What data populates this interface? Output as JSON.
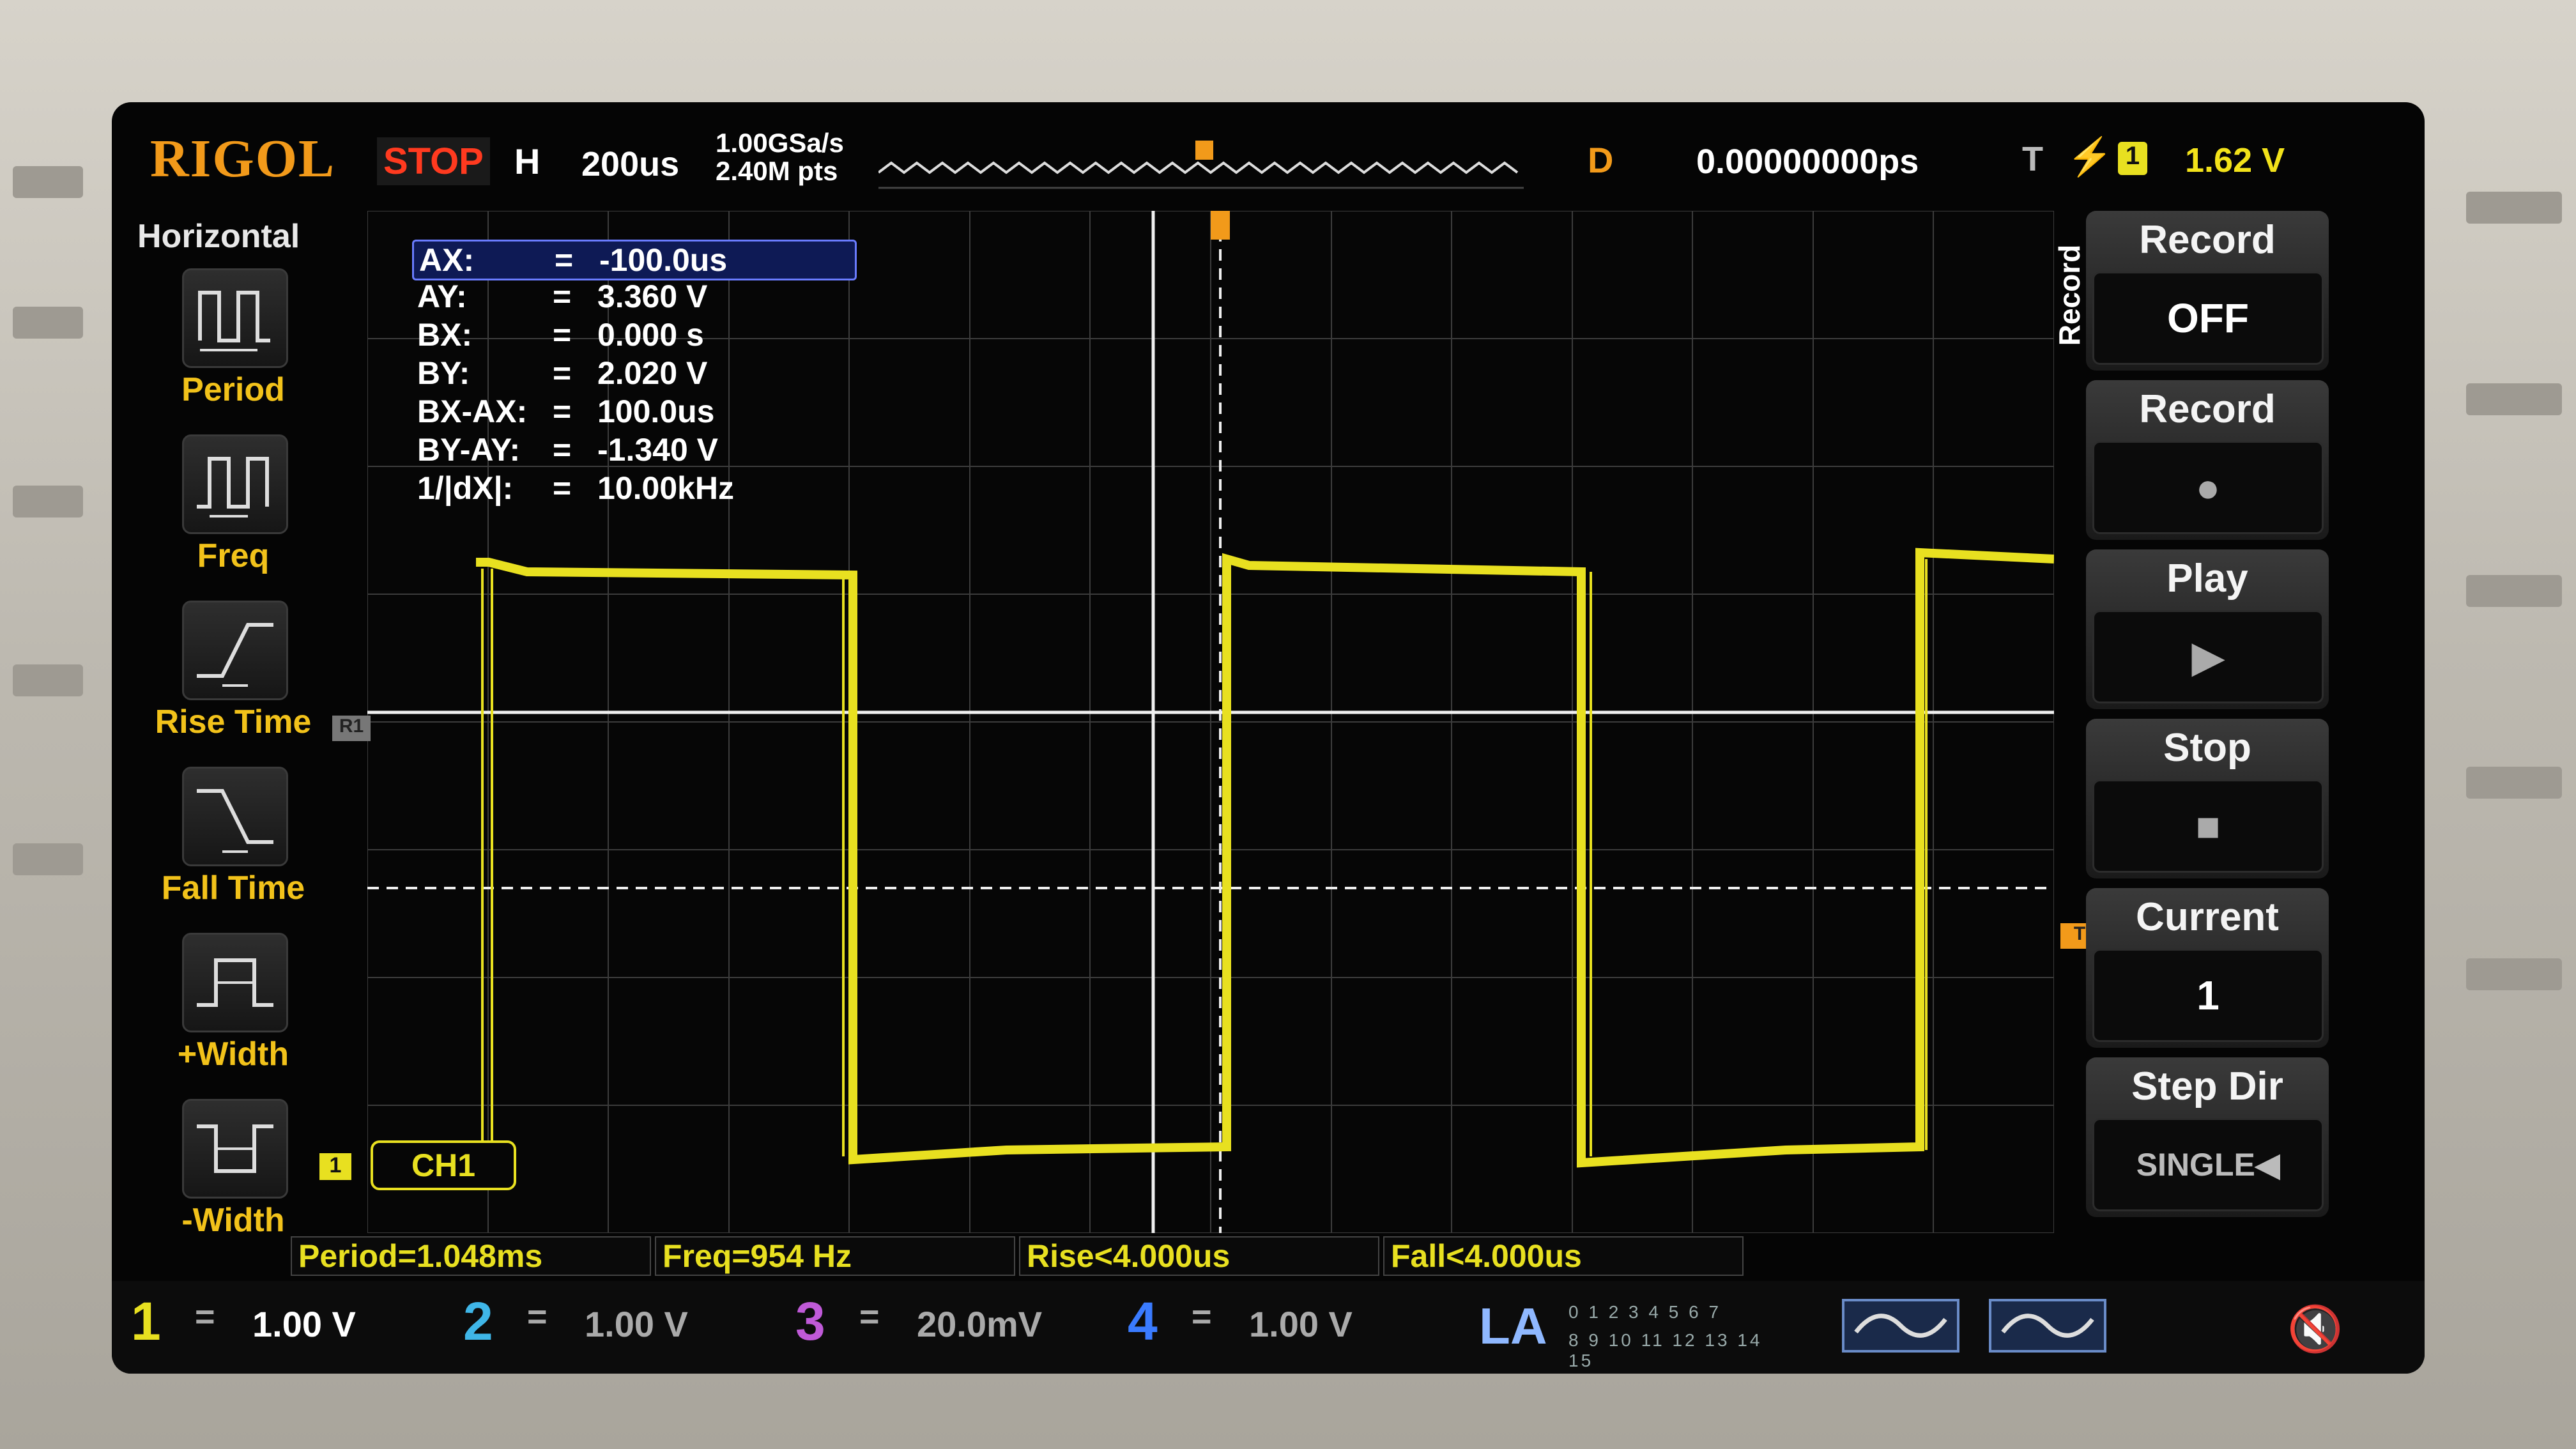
{
  "topbar": {
    "brand": "RIGOL",
    "run_status": "STOP",
    "horizontal_mode": "H",
    "timebase": "200us",
    "sample_rate": "1.00GSa/s",
    "memory_depth": "2.40M pts",
    "delay_mode": "D",
    "delay": "0.00000000ps",
    "trigger_type": "T",
    "trigger_edge_icon": "rising-edge-icon",
    "trigger_source": "1",
    "trigger_level": "1.62 V"
  },
  "left_menu": {
    "title": "Horizontal",
    "items": [
      {
        "label": "Period",
        "icon": "period-icon"
      },
      {
        "label": "Freq",
        "icon": "freq-icon"
      },
      {
        "label": "Rise Time",
        "icon": "rise-time-icon"
      },
      {
        "label": "Fall Time",
        "icon": "fall-time-icon"
      },
      {
        "label": "+Width",
        "icon": "positive-width-icon"
      },
      {
        "label": "-Width",
        "icon": "negative-width-icon"
      }
    ]
  },
  "cursor_readout": [
    {
      "key": "AX:",
      "eq": "=",
      "value": "-100.0us"
    },
    {
      "key": "AY:",
      "eq": "=",
      "value": "3.360 V"
    },
    {
      "key": "BX:",
      "eq": "=",
      "value": "0.000 s"
    },
    {
      "key": "BY:",
      "eq": "=",
      "value": "2.020 V"
    },
    {
      "key": "BX-AX:",
      "eq": "=",
      "value": "100.0us"
    },
    {
      "key": "BY-AY:",
      "eq": "=",
      "value": "-1.340 V"
    },
    {
      "key": "1/|dX|:",
      "eq": "=",
      "value": "10.00kHz"
    }
  ],
  "markers": {
    "ch1_marker": "1",
    "ch1_tag": "CH1",
    "ref_marker": "R1",
    "trigger_level_marker": "T"
  },
  "right_menu": {
    "vertical_title": "Record",
    "buttons": [
      {
        "title": "Record",
        "value": "OFF"
      },
      {
        "title": "Record",
        "value": "●"
      },
      {
        "title": "Play",
        "value": "▶"
      },
      {
        "title": "Stop",
        "value": "■"
      },
      {
        "title": "Current",
        "value": "1"
      },
      {
        "title": "Step Dir",
        "value": "SINGLE◀"
      }
    ]
  },
  "measurements": [
    "Period=1.048ms",
    "Freq=954 Hz",
    "Rise<4.000us",
    "Fall<4.000us"
  ],
  "channels": [
    {
      "num": "1",
      "eq": "=",
      "scale": "1.00 V",
      "color": "#e8e020"
    },
    {
      "num": "2",
      "eq": "=",
      "scale": "1.00 V",
      "color": "#3fb6e8"
    },
    {
      "num": "3",
      "eq": "=",
      "scale": "20.0mV",
      "color": "#c05ad8"
    },
    {
      "num": "4",
      "eq": "=",
      "scale": "1.00 V",
      "color": "#3a7bff"
    }
  ],
  "logic_analyzer": {
    "label": "LA",
    "bits_row1": "0 1 2 3  4 5 6 7",
    "bits_row2": "8 9 10 11  12 13 14 15"
  },
  "colors": {
    "ch1": "#e8e020",
    "brand": "#f29a1a",
    "stop": "#ff3a1f",
    "grid": "#4a4a4a"
  },
  "icons": {
    "mute": "mute-icon"
  }
}
